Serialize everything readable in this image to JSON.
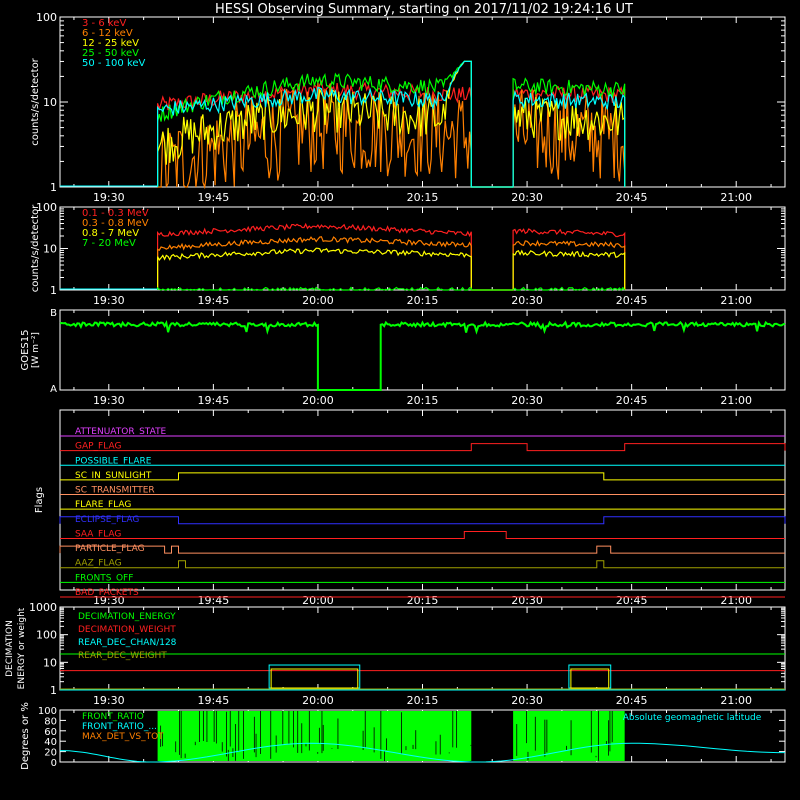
{
  "title": "HESSI Observing Summary, starting on 2017/11/02 19:24:16 UT",
  "colors": {
    "background": "#000000",
    "axes": "#ffffff",
    "red": "#ff2020",
    "orange": "#ff8000",
    "yellow": "#ffff00",
    "green": "#00ff00",
    "cyan": "#00ffff",
    "magenta": "#e040ff",
    "blue": "#3030ff",
    "olive": "#a0a000",
    "salmon": "#ff9060"
  },
  "time_ticks": [
    "19:30",
    "19:45",
    "20:00",
    "20:15",
    "20:30",
    "20:45",
    "21:00"
  ],
  "chart_data": [
    {
      "type": "line",
      "id": "panel1",
      "ylabel": "counts/s/detector",
      "yscale": "log",
      "ylim": [
        1,
        100
      ],
      "ytick_labels": [
        "1",
        "10",
        "100"
      ],
      "data_intervals": [
        [
          "19:37",
          "20:22"
        ],
        [
          "20:28",
          "20:44"
        ]
      ],
      "series": [
        {
          "name": "3 - 6 keV",
          "color": "#ff2020",
          "level_start": 9,
          "level_peak": 14,
          "level_end": 12
        },
        {
          "name": "6 - 12 keV",
          "color": "#ff8000",
          "level_start": 1.5,
          "level_peak": 5,
          "level_end": 4
        },
        {
          "name": "12 - 25 keV",
          "color": "#ffff00",
          "level_start": 3,
          "level_peak": 8,
          "level_end": 6
        },
        {
          "name": "25 - 50 keV",
          "color": "#00ff00",
          "level_start": 7,
          "level_peak": 18,
          "level_end": 14
        },
        {
          "name": "50 - 100 keV",
          "color": "#00ffff",
          "level_start": 8,
          "level_peak": 12,
          "level_end": 10
        }
      ],
      "spike": {
        "time": "20:21",
        "value": 30
      }
    },
    {
      "type": "line",
      "id": "panel2",
      "ylabel": "counts/s/detector",
      "yscale": "log",
      "ylim": [
        1,
        100
      ],
      "ytick_labels": [
        "1",
        "10",
        "100"
      ],
      "data_intervals": [
        [
          "19:37",
          "20:22"
        ],
        [
          "20:28",
          "20:44"
        ]
      ],
      "series": [
        {
          "name": "0.1 - 0.3 MeV",
          "color": "#ff2020",
          "level_start": 22,
          "level_peak": 35,
          "level_end": 22
        },
        {
          "name": "0.3 - 0.8 MeV",
          "color": "#ff8000",
          "level_start": 10,
          "level_peak": 17,
          "level_end": 12
        },
        {
          "name": "0.8 - 7 MeV",
          "color": "#ffff00",
          "level_start": 6,
          "level_peak": 9,
          "level_end": 7
        },
        {
          "name": "7 - 20 MeV",
          "color": "#00ff00",
          "level_start": 1,
          "level_peak": 1,
          "level_end": 1
        }
      ]
    },
    {
      "type": "line",
      "id": "panel3",
      "ylabel": "GOES15",
      "yunit": "[W m⁻²]",
      "ytick_labels": [
        "A",
        "B"
      ],
      "series": [
        {
          "name": "GOES15",
          "color": "#00ff00",
          "level": 0.82,
          "gap": [
            "20:00",
            "20:09"
          ]
        }
      ]
    },
    {
      "type": "line",
      "id": "flags",
      "ylabel": "Flags",
      "flags": [
        {
          "name": "ATTENUATOR_STATE",
          "color": "#e040ff",
          "on": []
        },
        {
          "name": "GAP_FLAG",
          "color": "#ff2020",
          "on": [
            [
              "20:22",
              "20:30"
            ],
            [
              "20:44",
              "21:07"
            ]
          ]
        },
        {
          "name": "POSSIBLE_FLARE",
          "color": "#00ffff",
          "on": []
        },
        {
          "name": "SC_IN_SUNLIGHT",
          "color": "#ffff00",
          "on": [
            [
              "19:40",
              "20:41"
            ]
          ]
        },
        {
          "name": "SC_TRANSMITTER",
          "color": "#ff9060",
          "on": []
        },
        {
          "name": "FLARE_FLAG",
          "color": "#ffff00",
          "on": []
        },
        {
          "name": "ECLIPSE_FLAG",
          "color": "#3030ff",
          "on": [
            [
              "19:23",
              "19:40"
            ],
            [
              "20:41",
              "21:07"
            ]
          ]
        },
        {
          "name": "SAA_FLAG",
          "color": "#ff2020",
          "on": [
            [
              "20:21",
              "20:27"
            ]
          ]
        },
        {
          "name": "PARTICLE_FLAG",
          "color": "#ff9060",
          "on": [
            [
              "19:23",
              "19:38"
            ],
            [
              "19:39",
              "19:40"
            ],
            [
              "20:40",
              "20:42"
            ]
          ]
        },
        {
          "name": "AAZ_FLAG",
          "color": "#a0a000",
          "on": [
            [
              "19:40",
              "19:41"
            ],
            [
              "20:40",
              "20:41"
            ]
          ]
        },
        {
          "name": "FRONTS_OFF",
          "color": "#00ff00",
          "on": []
        },
        {
          "name": "BAD_PACKETS",
          "color": "#ff2020",
          "on": []
        }
      ]
    },
    {
      "type": "line",
      "id": "decimation",
      "ylabel": "DECIMATION ENERGY or weight",
      "yscale": "log",
      "ylim": [
        1,
        1000
      ],
      "ytick_labels": [
        "1",
        "10",
        "100",
        "1000"
      ],
      "series": [
        {
          "name": "DECIMATION_ENERGY",
          "color": "#00ff00",
          "value": 20
        },
        {
          "name": "DECIMATION_WEIGHT",
          "color": "#ff2020",
          "value": 5
        },
        {
          "name": "REAR_DEC_CHAN/128",
          "color": "#00ffff",
          "value": 1,
          "boxes": [
            [
              "19:53",
              "20:06"
            ],
            [
              "20:36",
              "20:42"
            ]
          ],
          "box_value": 8
        },
        {
          "name": "REAR_DEC_WEIGHT",
          "color": "#a0a000",
          "value": 1
        }
      ]
    },
    {
      "type": "line",
      "id": "ratio",
      "ylabel": "Degrees or %",
      "ylim": [
        0,
        100
      ],
      "ytick_labels": [
        "0",
        "20",
        "40",
        "60",
        "80",
        "100"
      ],
      "series": [
        {
          "name": "FRONT_RATIO",
          "color": "#00ff00",
          "intervals": [
            [
              "19:37",
              "20:22"
            ],
            [
              "20:28",
              "20:44"
            ]
          ]
        },
        {
          "name": "FRONT_RATIO_...",
          "color": "#00ffff"
        },
        {
          "name": "MAX_DET_VS_TOT",
          "color": "#ff8000"
        },
        {
          "name": "Absolute geomagnetic latitude",
          "color": "#00ffff",
          "points": [
            [
              "19:23",
              22
            ],
            [
              "19:36",
              0
            ],
            [
              "19:59",
              36
            ],
            [
              "20:23",
              0
            ],
            [
              "20:45",
              36
            ],
            [
              "21:07",
              18
            ]
          ]
        }
      ]
    }
  ]
}
